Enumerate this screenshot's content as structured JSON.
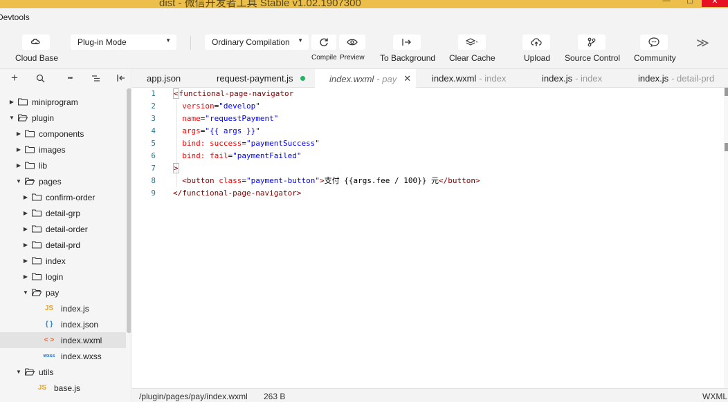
{
  "window": {
    "title": "dist - 微信开发者工具 Stable v1.02.1907300",
    "minimize_glyph": "—",
    "maximize_glyph": "☐",
    "close_glyph": "✕"
  },
  "menubar": {
    "devtools_label": "Devtools"
  },
  "toolbar": {
    "cloud_base_label": "Cloud Base",
    "mode_select_value": "Plug-in Mode",
    "compile_select_value": "Ordinary Compilation",
    "compile_label": "Compile",
    "preview_label": "Preview",
    "background_label": "To Background",
    "clear_cache_label": "Clear Cache",
    "upload_label": "Upload",
    "source_control_label": "Source Control",
    "community_label": "Community",
    "more_glyph": "≫"
  },
  "sidebar": {
    "tools": [
      "+",
      "⌕",
      "•••",
      "≡",
      "⊢"
    ],
    "tree": [
      {
        "label": "miniprogram",
        "kind": "folder",
        "expanded": false,
        "depth": 0
      },
      {
        "label": "plugin",
        "kind": "folder",
        "expanded": true,
        "depth": 0
      },
      {
        "label": "components",
        "kind": "folder",
        "expanded": false,
        "depth": 1
      },
      {
        "label": "images",
        "kind": "folder",
        "expanded": false,
        "depth": 1
      },
      {
        "label": "lib",
        "kind": "folder",
        "expanded": false,
        "depth": 1
      },
      {
        "label": "pages",
        "kind": "folder",
        "expanded": true,
        "depth": 1
      },
      {
        "label": "confirm-order",
        "kind": "folder",
        "expanded": false,
        "depth": 2
      },
      {
        "label": "detail-grp",
        "kind": "folder",
        "expanded": false,
        "depth": 2
      },
      {
        "label": "detail-order",
        "kind": "folder",
        "expanded": false,
        "depth": 2
      },
      {
        "label": "detail-prd",
        "kind": "folder",
        "expanded": false,
        "depth": 2
      },
      {
        "label": "index",
        "kind": "folder",
        "expanded": false,
        "depth": 2
      },
      {
        "label": "login",
        "kind": "folder",
        "expanded": false,
        "depth": 2
      },
      {
        "label": "pay",
        "kind": "folder",
        "expanded": true,
        "depth": 2
      },
      {
        "label": "index.js",
        "kind": "js",
        "badge": "JS",
        "depth": 3
      },
      {
        "label": "index.json",
        "kind": "json",
        "badge": "{ }",
        "depth": 3
      },
      {
        "label": "index.wxml",
        "kind": "wxml",
        "badge": "< >",
        "depth": 3,
        "selected": true
      },
      {
        "label": "index.wxss",
        "kind": "wxss",
        "badge": "wxss",
        "depth": 3
      },
      {
        "label": "utils",
        "kind": "folder",
        "expanded": true,
        "depth": 1
      },
      {
        "label": "base.js",
        "kind": "js",
        "badge": "JS",
        "depth": 2
      }
    ]
  },
  "tabs": [
    {
      "name": "app.json",
      "muted": ""
    },
    {
      "name": "request-payment.js",
      "muted": ""
    },
    {
      "name": "index.wxml",
      "muted": "- pay"
    },
    {
      "name": "index.wxml",
      "muted": "- index"
    },
    {
      "name": "index.js",
      "muted": "- index"
    },
    {
      "name": "index.js",
      "muted": "- detail-prd"
    }
  ],
  "tab_close_glyph": "✕",
  "editor": {
    "line_numbers": [
      "1",
      "2",
      "3",
      "4",
      "5",
      "6",
      "7",
      "8",
      "9"
    ],
    "lines": [
      [
        [
          "tag",
          "<"
        ],
        [
          "tag",
          "functional-page-navigator"
        ]
      ],
      [
        [
          "attr",
          "  version"
        ],
        [
          "txt",
          "="
        ],
        [
          "str",
          "\"develop\""
        ]
      ],
      [
        [
          "attr",
          "  name"
        ],
        [
          "txt",
          "="
        ],
        [
          "str",
          "\"requestPayment\""
        ]
      ],
      [
        [
          "attr",
          "  args"
        ],
        [
          "txt",
          "="
        ],
        [
          "str",
          "\"{{ args }}\""
        ]
      ],
      [
        [
          "attr",
          "  bind: success"
        ],
        [
          "txt",
          "="
        ],
        [
          "str",
          "\"paymentSuccess\""
        ]
      ],
      [
        [
          "attr",
          "  bind: fail"
        ],
        [
          "txt",
          "="
        ],
        [
          "str",
          "\"paymentFailed\""
        ]
      ],
      [
        [
          "tag",
          ">"
        ]
      ],
      [
        [
          "tag",
          "  <button"
        ],
        [
          "txt",
          " "
        ],
        [
          "attr",
          "class"
        ],
        [
          "txt",
          "="
        ],
        [
          "str",
          "\"payment-button\""
        ],
        [
          "tag",
          ">"
        ],
        [
          "txt",
          "支付 {{args.fee / 100}} 元"
        ],
        [
          "tag",
          "</button>"
        ]
      ],
      [
        [
          "tag",
          "</functional-page-navigator>"
        ]
      ]
    ]
  },
  "statusbar": {
    "path": "/plugin/pages/pay/index.wxml",
    "size": "263 B",
    "language": "WXML"
  },
  "colors": {
    "titlebar": "#ecbe4a",
    "modified_dot": "#27b063",
    "js_icon": "#e8a317",
    "json_icon": "#1f8ad6",
    "wxml_icon": "#e8642d",
    "wxss_icon": "#1f6fc6"
  }
}
